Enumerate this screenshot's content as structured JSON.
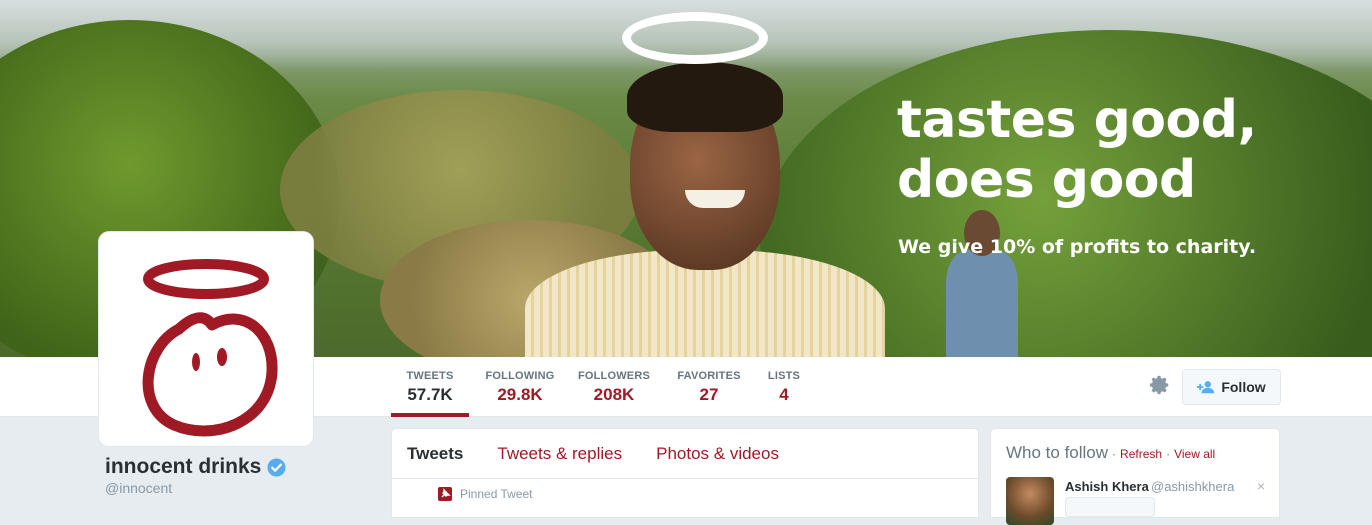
{
  "banner": {
    "headline": "tastes good,\ndoes good",
    "subline": "We give 10% of profits to charity."
  },
  "stats": [
    {
      "label": "TWEETS",
      "value": "57.7K",
      "active": true
    },
    {
      "label": "FOLLOWING",
      "value": "29.8K",
      "active": false
    },
    {
      "label": "FOLLOWERS",
      "value": "208K",
      "active": false
    },
    {
      "label": "FAVORITES",
      "value": "27",
      "active": false
    },
    {
      "label": "LISTS",
      "value": "4",
      "active": false
    }
  ],
  "actions": {
    "follow_label": "Follow",
    "settings_icon": "gear-icon",
    "follow_icon": "add-user-icon"
  },
  "profile": {
    "name": "innocent drinks",
    "handle": "@innocent",
    "verified": true
  },
  "timeline": {
    "tabs": [
      "Tweets",
      "Tweets & replies",
      "Photos & videos"
    ],
    "pinned_label": "Pinned Tweet"
  },
  "who_to_follow": {
    "title": "Who to follow",
    "separator": "·",
    "refresh": "Refresh",
    "view_all": "View all",
    "suggestions": [
      {
        "name": "Ashish Khera",
        "handle": "@ashishkhera",
        "close": "×"
      }
    ]
  },
  "colors": {
    "brand": "#a01a25",
    "text": "#292f33",
    "muted": "#8899a6",
    "background": "#e6ecf0",
    "verified": "#55acee"
  }
}
